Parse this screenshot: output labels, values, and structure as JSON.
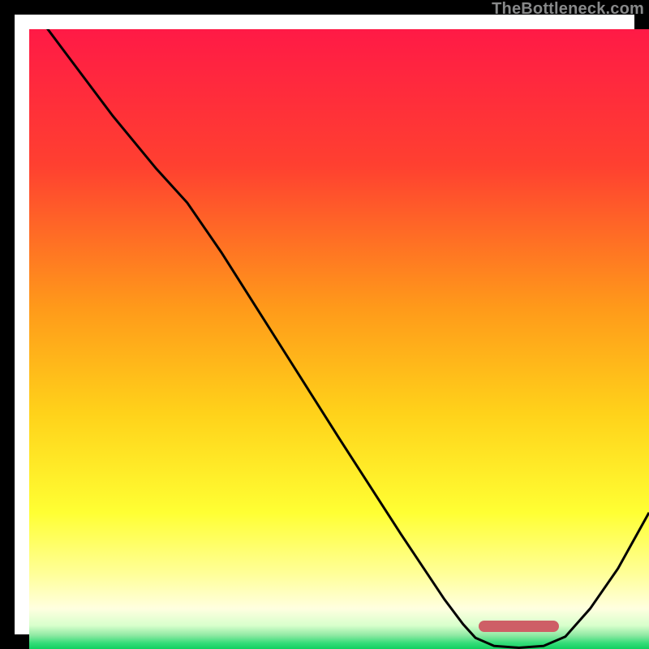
{
  "watermark": "TheBottleneck.com",
  "colors": {
    "border": "#000000",
    "marker": "#ce5f66",
    "gradient_stops": [
      {
        "offset": 0.0,
        "color": "#ff1a46"
      },
      {
        "offset": 0.22,
        "color": "#ff4030"
      },
      {
        "offset": 0.45,
        "color": "#ff9a1a"
      },
      {
        "offset": 0.62,
        "color": "#ffd21a"
      },
      {
        "offset": 0.78,
        "color": "#ffff33"
      },
      {
        "offset": 0.88,
        "color": "#ffff9a"
      },
      {
        "offset": 0.935,
        "color": "#ffffe0"
      },
      {
        "offset": 0.962,
        "color": "#d8ffcc"
      },
      {
        "offset": 0.978,
        "color": "#8fe9a3"
      },
      {
        "offset": 0.99,
        "color": "#37dd7a"
      },
      {
        "offset": 1.0,
        "color": "#10d060"
      }
    ]
  },
  "marker": {
    "x_start": 0.725,
    "x_end": 0.855,
    "y_frac_from_bottom": 0.028
  },
  "chart_data": {
    "type": "line",
    "title": "",
    "xlabel": "",
    "ylabel": "",
    "xlim": [
      0,
      1
    ],
    "ylim": [
      0,
      1
    ],
    "grid": false,
    "legend": false,
    "series": [
      {
        "name": "bottleneck-curve",
        "points": [
          {
            "x": 0.0,
            "y": 1.04
          },
          {
            "x": 0.06,
            "y": 0.96
          },
          {
            "x": 0.135,
            "y": 0.86
          },
          {
            "x": 0.205,
            "y": 0.775
          },
          {
            "x": 0.255,
            "y": 0.72
          },
          {
            "x": 0.31,
            "y": 0.64
          },
          {
            "x": 0.4,
            "y": 0.498
          },
          {
            "x": 0.5,
            "y": 0.34
          },
          {
            "x": 0.6,
            "y": 0.185
          },
          {
            "x": 0.67,
            "y": 0.08
          },
          {
            "x": 0.7,
            "y": 0.04
          },
          {
            "x": 0.72,
            "y": 0.018
          },
          {
            "x": 0.75,
            "y": 0.005
          },
          {
            "x": 0.79,
            "y": 0.002
          },
          {
            "x": 0.83,
            "y": 0.005
          },
          {
            "x": 0.865,
            "y": 0.02
          },
          {
            "x": 0.905,
            "y": 0.065
          },
          {
            "x": 0.95,
            "y": 0.13
          },
          {
            "x": 1.0,
            "y": 0.22
          }
        ]
      }
    ],
    "flat_region": {
      "x_start": 0.725,
      "x_end": 0.855,
      "y": 0.004
    }
  }
}
